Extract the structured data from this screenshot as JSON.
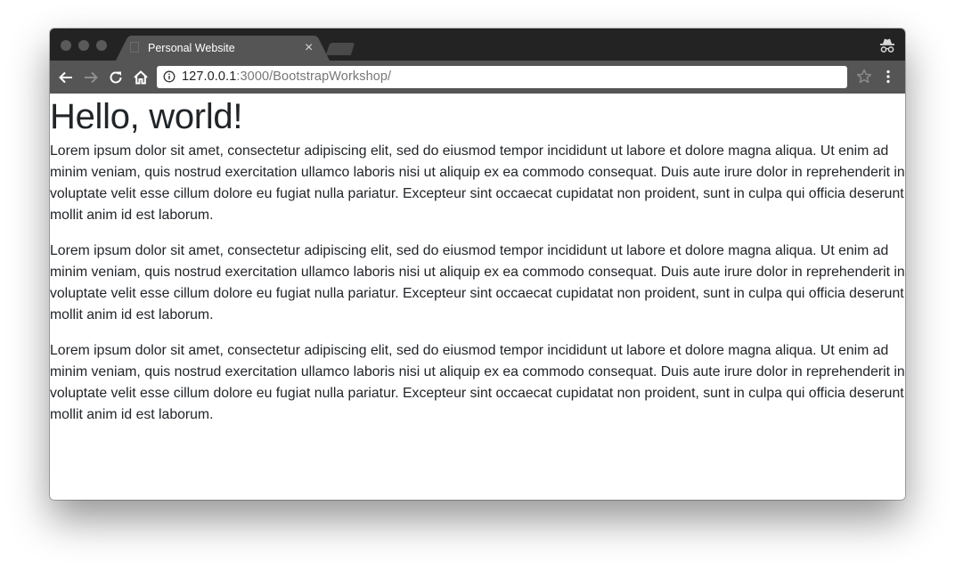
{
  "browser": {
    "tab_title": "Personal Website",
    "tab_close": "×",
    "url_host": "127.0.0.1",
    "url_rest": ":3000/BootstrapWorkshop/"
  },
  "page": {
    "heading": "Hello, world!",
    "paragraphs": [
      "Lorem ipsum dolor sit amet, consectetur adipiscing elit, sed do eiusmod tempor incididunt ut labore et dolore magna aliqua. Ut enim ad minim veniam, quis nostrud exercitation ullamco laboris nisi ut aliquip ex ea commodo consequat. Duis aute irure dolor in reprehenderit in voluptate velit esse cillum dolore eu fugiat nulla pariatur. Excepteur sint occaecat cupidatat non proident, sunt in culpa qui officia deserunt mollit anim id est laborum.",
      "Lorem ipsum dolor sit amet, consectetur adipiscing elit, sed do eiusmod tempor incididunt ut labore et dolore magna aliqua. Ut enim ad minim veniam, quis nostrud exercitation ullamco laboris nisi ut aliquip ex ea commodo consequat. Duis aute irure dolor in reprehenderit in voluptate velit esse cillum dolore eu fugiat nulla pariatur. Excepteur sint occaecat cupidatat non proident, sunt in culpa qui officia deserunt mollit anim id est laborum.",
      "Lorem ipsum dolor sit amet, consectetur adipiscing elit, sed do eiusmod tempor incididunt ut labore et dolore magna aliqua. Ut enim ad minim veniam, quis nostrud exercitation ullamco laboris nisi ut aliquip ex ea commodo consequat. Duis aute irure dolor in reprehenderit in voluptate velit esse cillum dolore eu fugiat nulla pariatur. Excepteur sint occaecat cupidatat non proident, sunt in culpa qui officia deserunt mollit anim id est laborum."
    ]
  },
  "icons": {
    "window_controls": [
      "close-icon",
      "minimize-icon",
      "maximize-icon"
    ],
    "tab": "page-icon",
    "incognito": "incognito-icon",
    "nav": [
      "back-arrow-icon",
      "forward-arrow-icon",
      "reload-icon",
      "home-icon"
    ],
    "omnibox": "info-icon",
    "bookmark": "star-icon",
    "menu": "more-vertical-icon"
  },
  "colors": {
    "titlebar": "#232323",
    "toolbar": "#555555",
    "tab_active": "#555555",
    "page_text": "#212529"
  }
}
